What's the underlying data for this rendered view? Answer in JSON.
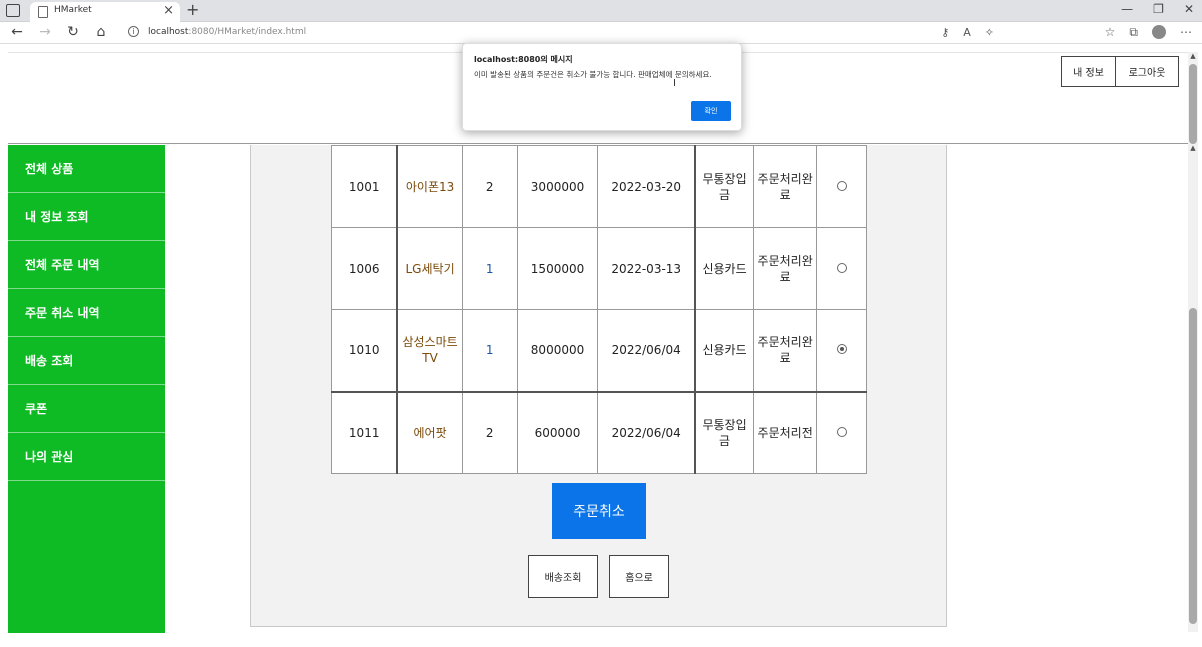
{
  "browser": {
    "tab_title": "HMarket",
    "url_host": "localhost",
    "url_rest": ":8080/HMarket/index.html"
  },
  "header": {
    "my_info_label": "내 정보",
    "logout_label": "로그아웃"
  },
  "sidebar": {
    "items": [
      {
        "label": "전체 상품"
      },
      {
        "label": "내 정보 조회"
      },
      {
        "label": "전체 주문 내역"
      },
      {
        "label": "주문 취소 내역"
      },
      {
        "label": "배송 조회"
      },
      {
        "label": "쿠폰"
      },
      {
        "label": "나의 관심"
      }
    ]
  },
  "orders": {
    "rows": [
      {
        "id": "1001",
        "name": "아이폰13",
        "qty": "2",
        "price": "3000000",
        "date": "2022-03-20",
        "payment": "무통장입금",
        "status": "주문처리완료",
        "selected": false
      },
      {
        "id": "1006",
        "name": "LG세탁기",
        "qty": "1",
        "price": "1500000",
        "date": "2022-03-13",
        "payment": "신용카드",
        "status": "주문처리완료",
        "selected": false
      },
      {
        "id": "1010",
        "name": "삼성스마트TV",
        "qty": "1",
        "price": "8000000",
        "date": "2022/06/04",
        "payment": "신용카드",
        "status": "주문처리완료",
        "selected": true
      },
      {
        "id": "1011",
        "name": "에어팟",
        "qty": "2",
        "price": "600000",
        "date": "2022/06/04",
        "payment": "무통장입금",
        "status": "주문처리전",
        "selected": false
      }
    ]
  },
  "actions": {
    "cancel_order_label": "주문취소",
    "track_delivery_label": "배송조회",
    "home_label": "홈으로"
  },
  "alert": {
    "title": "localhost:8080의 메시지",
    "message": "이미 발송된 상품의 주문건은 취소가 불가능 합니다. 판매업체에 문의하세요.",
    "ok_label": "확인"
  },
  "colors": {
    "sidebar_green": "#0fbb25",
    "primary_blue": "#0a74e8"
  }
}
